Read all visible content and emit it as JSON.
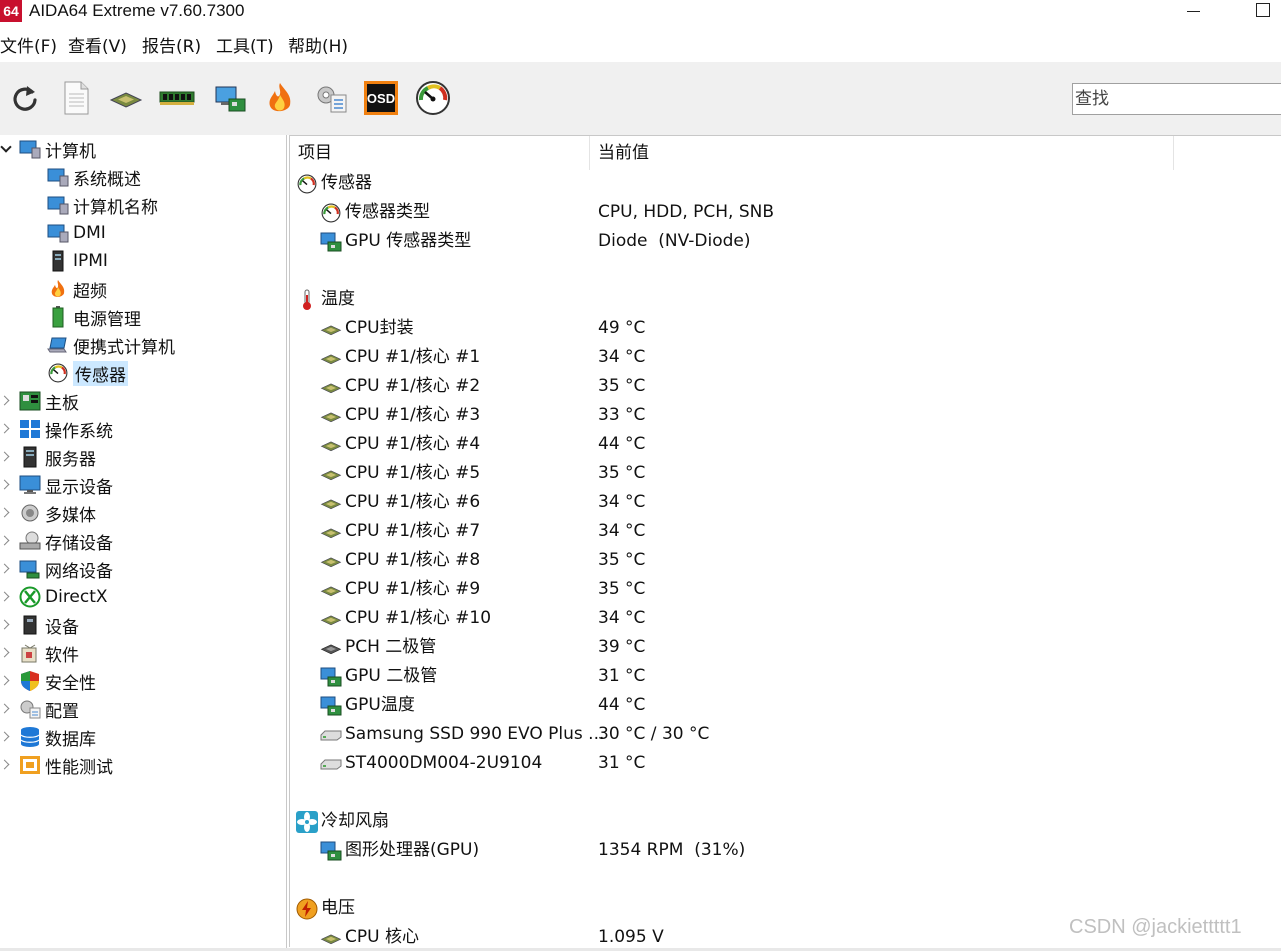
{
  "window": {
    "app_icon_text": "64",
    "title": "AIDA64 Extreme v7.60.7300"
  },
  "menu": [
    "文件(F)",
    "查看(V)",
    "报告(R)",
    "工具(T)",
    "帮助(H)"
  ],
  "toolbar": {
    "buttons": [
      "refresh-icon",
      "report-icon",
      "cpu-icon",
      "memory-icon",
      "motherboard-icon",
      "flame-icon",
      "system-settings-icon",
      "osd-icon",
      "gauge-icon"
    ],
    "osd_label": "OSD",
    "search_placeholder": "查找"
  },
  "tree": {
    "root": "计算机",
    "children": [
      "系统概述",
      "计算机名称",
      "DMI",
      "IPMI",
      "超频",
      "电源管理",
      "便携式计算机",
      "传感器"
    ],
    "selected": "传感器",
    "top_level": [
      "主板",
      "操作系统",
      "服务器",
      "显示设备",
      "多媒体",
      "存储设备",
      "网络设备",
      "DirectX",
      "设备",
      "软件",
      "安全性",
      "配置",
      "数据库",
      "性能测试"
    ]
  },
  "list": {
    "col_item": "项目",
    "col_value": "当前值",
    "groups": [
      {
        "name": "传感器",
        "rows": [
          {
            "item": "传感器类型",
            "value": "CPU, HDD, PCH, SNB"
          },
          {
            "item": "GPU 传感器类型",
            "value": "Diode  (NV-Diode)"
          }
        ]
      },
      {
        "name": "温度",
        "rows": [
          {
            "item": "CPU封装",
            "value": "49 °C"
          },
          {
            "item": "CPU #1/核心 #1",
            "value": "34 °C"
          },
          {
            "item": "CPU #1/核心 #2",
            "value": "35 °C"
          },
          {
            "item": "CPU #1/核心 #3",
            "value": "33 °C"
          },
          {
            "item": "CPU #1/核心 #4",
            "value": "44 °C"
          },
          {
            "item": "CPU #1/核心 #5",
            "value": "35 °C"
          },
          {
            "item": "CPU #1/核心 #6",
            "value": "34 °C"
          },
          {
            "item": "CPU #1/核心 #7",
            "value": "34 °C"
          },
          {
            "item": "CPU #1/核心 #8",
            "value": "35 °C"
          },
          {
            "item": "CPU #1/核心 #9",
            "value": "35 °C"
          },
          {
            "item": "CPU #1/核心 #10",
            "value": "34 °C"
          },
          {
            "item": "PCH 二极管",
            "value": "39 °C"
          },
          {
            "item": "GPU 二极管",
            "value": "31 °C"
          },
          {
            "item": "GPU温度",
            "value": "44 °C"
          },
          {
            "item": "Samsung SSD 990 EVO Plus ...",
            "value": "30 °C / 30 °C"
          },
          {
            "item": "ST4000DM004-2U9104",
            "value": "31 °C"
          }
        ]
      },
      {
        "name": "冷却风扇",
        "rows": [
          {
            "item": "图形处理器(GPU)",
            "value": "1354 RPM  (31%)"
          }
        ]
      },
      {
        "name": "电压",
        "rows": [
          {
            "item": "CPU 核心",
            "value": "1.095 V"
          }
        ]
      }
    ]
  },
  "watermark": "CSDN @jackiettttt1"
}
